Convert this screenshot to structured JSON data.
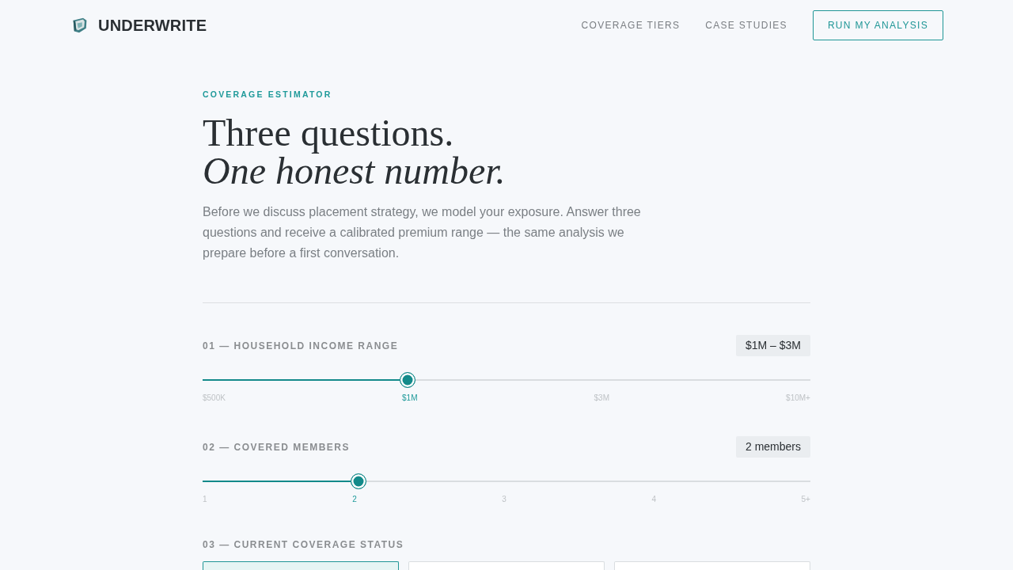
{
  "header": {
    "brand": "UNDERWRITE",
    "nav": [
      "COVERAGE TIERS",
      "CASE STUDIES"
    ],
    "cta": "RUN MY ANALYSIS"
  },
  "intro": {
    "eyebrow": "COVERAGE ESTIMATOR",
    "headline": "Three questions.",
    "headline_italic": "One honest number.",
    "description": "Before we discuss placement strategy, we model your exposure. Answer three questions and receive a calibrated premium range — the same analysis we prepare before a first conversation."
  },
  "questions": [
    {
      "kind": "slider",
      "label": "01 — HOUSEHOLD INCOME RANGE",
      "value": "$1M – $3M",
      "level": 0.337,
      "ticks": [
        {
          "label": "$500K",
          "selected": false
        },
        {
          "label": "$1M",
          "selected": true
        },
        {
          "label": "$3M",
          "selected": false
        },
        {
          "label": "$10M+",
          "selected": false
        }
      ]
    },
    {
      "kind": "slider",
      "label": "02 — COVERED MEMBERS",
      "value": "2 members",
      "level": 0.256,
      "ticks": [
        {
          "label": "1",
          "selected": false
        },
        {
          "label": "2",
          "selected": true
        },
        {
          "label": "3",
          "selected": false
        },
        {
          "label": "4",
          "selected": false
        },
        {
          "label": "5+",
          "selected": false
        }
      ]
    },
    {
      "kind": "choice",
      "label": "03 — CURRENT COVERAGE STATUS",
      "options": [
        {
          "selected": true
        },
        {
          "selected": false
        },
        {
          "selected": false
        }
      ]
    }
  ]
}
